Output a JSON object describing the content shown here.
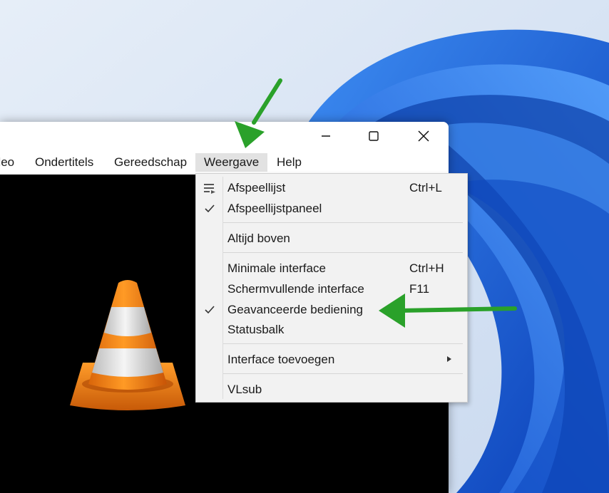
{
  "colors": {
    "annotation_arrow": "#2aa12a",
    "wallpaper_blue": "#1d6fe0",
    "menu_highlight": "#e2e2e2",
    "vlc_orange": "#f28a0e"
  },
  "title_bar": {
    "minimize_icon": "minimize-icon",
    "maximize_icon": "maximize-icon",
    "close_icon": "close-icon"
  },
  "menu_bar": {
    "items": [
      {
        "label": "ideo"
      },
      {
        "label": "Ondertitels"
      },
      {
        "label": "Gereedschap"
      },
      {
        "label": "Weergave"
      },
      {
        "label": "Help"
      }
    ]
  },
  "weergave_menu": {
    "items": [
      {
        "label": "Afspeellijst",
        "shortcut": "Ctrl+L",
        "icon": "playlist-icon"
      },
      {
        "label": "Afspeellijstpaneel",
        "shortcut": "",
        "checked": true
      },
      {
        "label": "Altijd boven",
        "shortcut": ""
      },
      {
        "label": "Minimale interface",
        "shortcut": "Ctrl+H"
      },
      {
        "label": "Schermvullende interface",
        "shortcut": "F11"
      },
      {
        "label": "Geavanceerde bediening",
        "shortcut": "",
        "checked": true
      },
      {
        "label": "Statusbalk",
        "shortcut": ""
      },
      {
        "label": "Interface toevoegen",
        "shortcut": "",
        "submenu": true
      },
      {
        "label": "VLsub",
        "shortcut": ""
      }
    ]
  }
}
